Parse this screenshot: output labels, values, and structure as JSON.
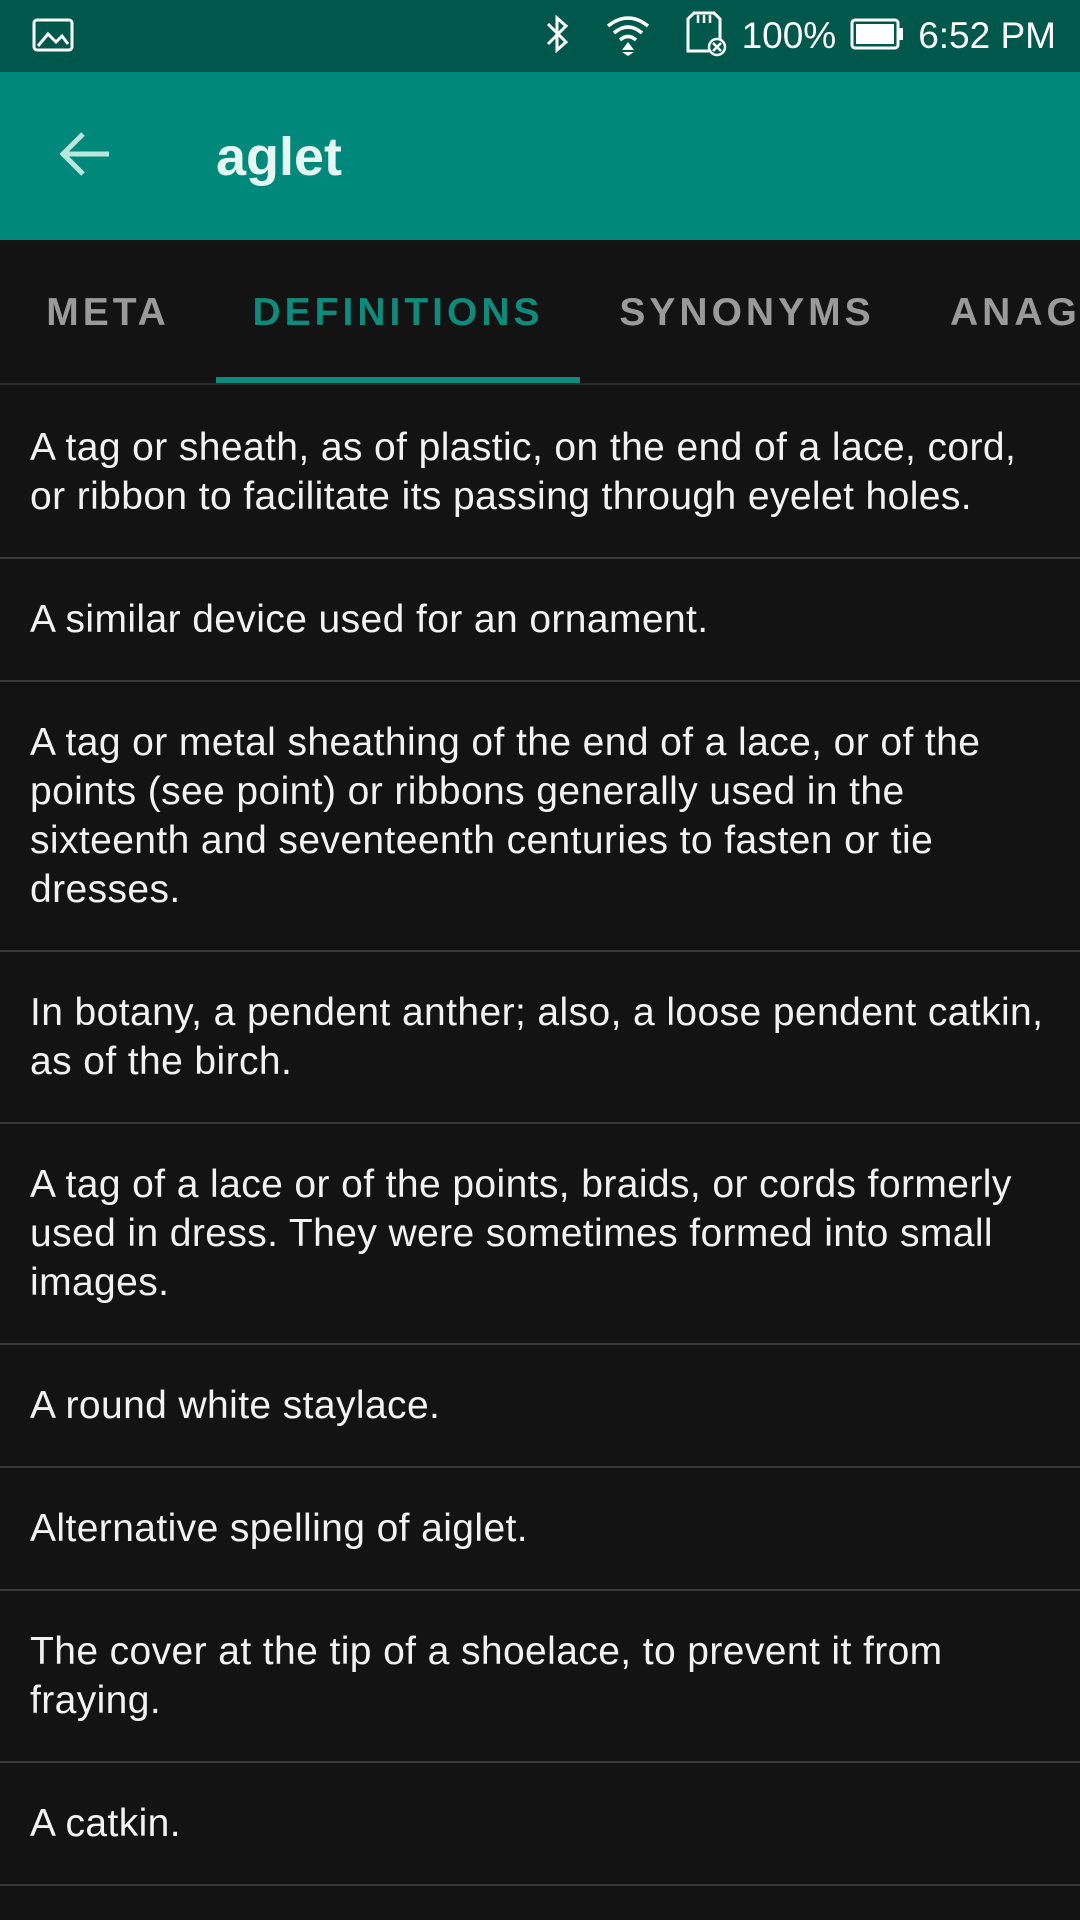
{
  "status_bar": {
    "battery": "100%",
    "time": "6:52 PM",
    "icons": [
      "image-icon",
      "bluetooth-icon",
      "wifi-icon",
      "sd-card-icon",
      "battery-icon"
    ]
  },
  "app_bar": {
    "title": "aglet",
    "back_icon": "arrow-left-icon"
  },
  "tabs": [
    {
      "label": "META",
      "active": false
    },
    {
      "label": "DEFINITIONS",
      "active": true
    },
    {
      "label": "SYNONYMS",
      "active": false
    },
    {
      "label": "ANAG",
      "active": false
    }
  ],
  "definitions": [
    "A tag or sheath, as of plastic, on the end of a lace, cord, or ribbon to facilitate its passing through eyelet holes.",
    "A similar device used for an ornament.",
    "A tag or metal sheathing of the end of a lace, or of the points (see point) or ribbons generally used in the sixteenth and seventeenth centuries to fasten or tie dresses.",
    "In botany, a pendent anther; also, a loose pendent catkin, as of the birch.",
    "A tag of a lace or of the points, braids, or cords formerly used in dress. They were sometimes formed into small images.",
    "A round white staylace.",
    "Alternative spelling of aiglet.",
    "The cover at the tip of a shoelace, to prevent it from fraying.",
    "A catkin."
  ],
  "colors": {
    "status_bar": "#00574b",
    "app_bar": "#00897b",
    "accent": "#0f8a7c",
    "background": "#131313"
  }
}
